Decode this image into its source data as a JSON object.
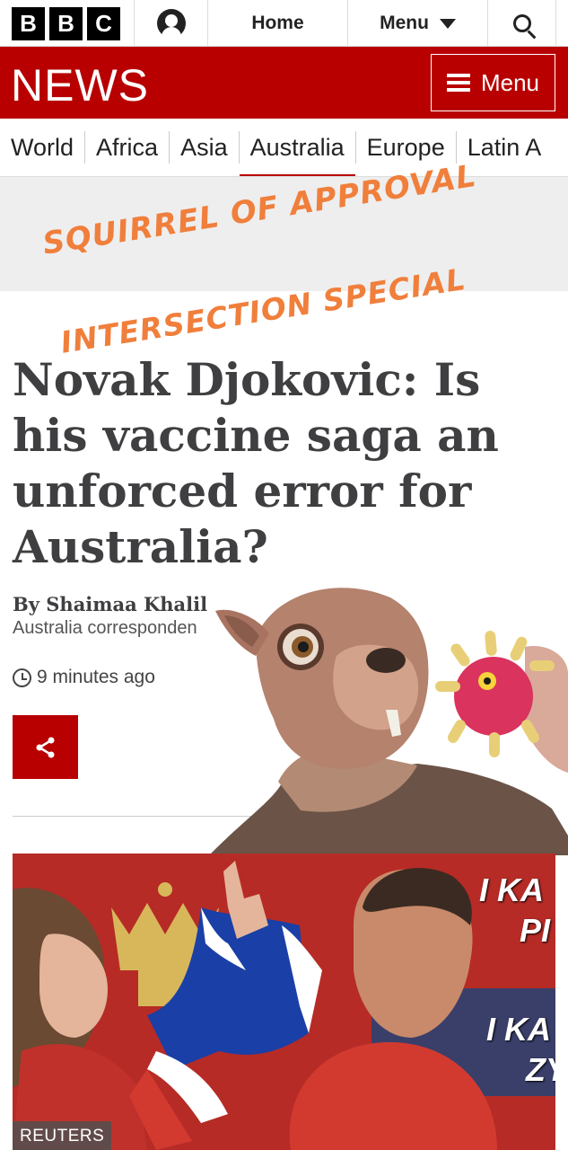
{
  "header": {
    "logo_letters": [
      "B",
      "B",
      "C"
    ],
    "home_label": "Home",
    "menu_label": "Menu"
  },
  "newsbar": {
    "logo_text": "NEWS",
    "menu_label": "Menu"
  },
  "nav": {
    "items": [
      "World",
      "Africa",
      "Asia",
      "Australia",
      "Europe",
      "Latin A"
    ],
    "active": "Australia"
  },
  "overlay": {
    "stamp_line1": "SQUIRREL OF APPROVAL",
    "stamp_line2": "INTERSECTION SPECIAL"
  },
  "article": {
    "headline": "Novak Djokovic: Is his vaccine saga an unforced error for Australia?",
    "byline": "By Shaimaa Khalil",
    "role": "Australia corresponden",
    "timestamp": "9 minutes ago"
  },
  "photo": {
    "caption": "REUTERS",
    "banner_line1": "I KA",
    "banner_line2": "PI",
    "banner_line3": "I KA",
    "banner_line4": "ZY"
  },
  "colors": {
    "bbc_red": "#b80000",
    "stamp_orange": "#f07f3c",
    "headline_grey": "#3f3f42"
  },
  "icons": [
    "account-icon",
    "chevron-down-icon",
    "search-icon",
    "hamburger-icon",
    "clock-icon",
    "share-icon"
  ]
}
